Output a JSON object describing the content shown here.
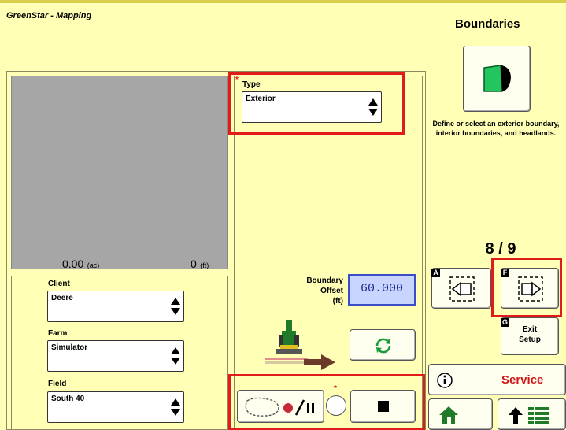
{
  "app": {
    "title": "GreenStar - Mapping",
    "page_title": "Boundaries"
  },
  "map": {
    "area_value": "0.00",
    "area_unit": "(ac)",
    "length_value": "0",
    "length_unit": "(ft)"
  },
  "type_selector": {
    "label": "Type",
    "value": "Exterior",
    "required_mark": "*"
  },
  "client": {
    "label": "Client",
    "value": "Deere"
  },
  "farm": {
    "label": "Farm",
    "value": "Simulator"
  },
  "field": {
    "label": "Field",
    "value": "South 40"
  },
  "boundary_offset": {
    "label_line1": "Boundary",
    "label_line2": "Offset",
    "unit": "(ft)",
    "value": "60.000"
  },
  "recording": {
    "required_mark": "*"
  },
  "right_panel": {
    "helper_text": "Define or select an exterior boundary, interior boundaries, and headlands.",
    "page_counter": "8 / 9",
    "prev_key": "A",
    "next_key": "F",
    "exit_key": "G",
    "exit_label_line1": "Exit",
    "exit_label_line2": "Setup",
    "service_label": "Service"
  },
  "colors": {
    "background": "#ffffb5",
    "highlight": "#e11b1b",
    "brand_green": "#1f7a2a",
    "service_red": "#d01818",
    "offset_blue": "#c9d4ff"
  }
}
